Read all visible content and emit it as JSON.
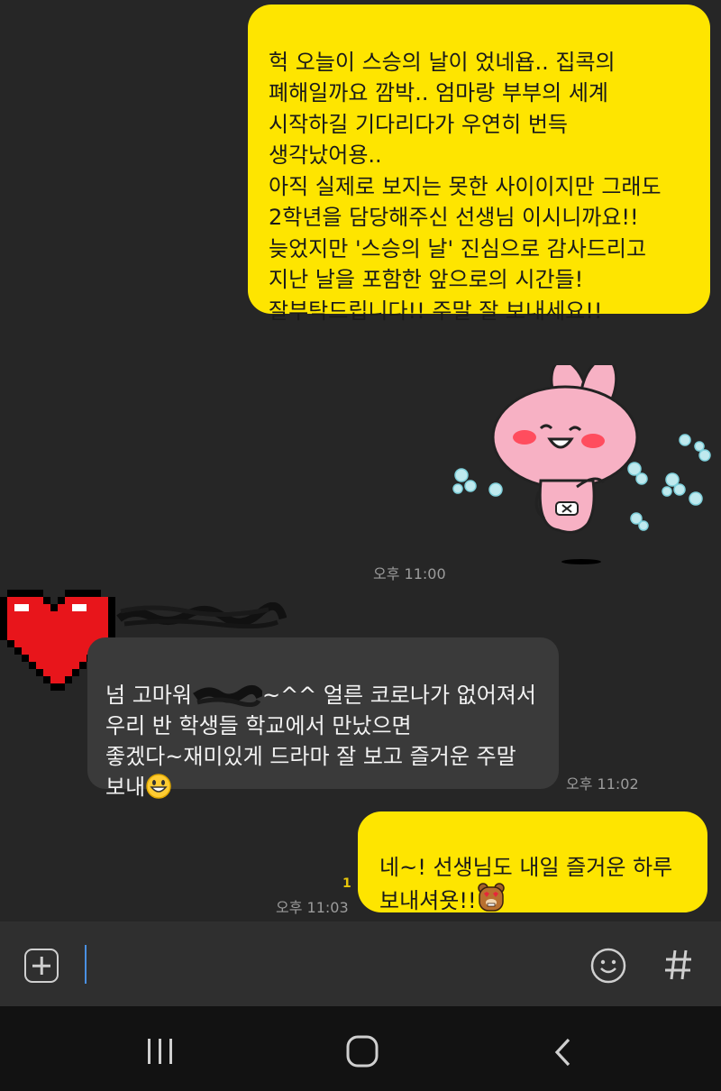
{
  "messages": {
    "sent_1": {
      "text": "헉 오늘이 스승의 날이 었네욥.. 집콕의\n폐해일까요 깜박.. 엄마랑 부부의 세계\n시작하길 기다리다가 우연히 번득\n생각났어용..\n아직 실제로 보지는 못한 사이이지만 그래도\n2학년을 담당해주신 선생님 이시니까요!!\n늦었지만 '스승의 날' 진심으로 감사드리고\n지난 날을 포함한  앞으로의 시간들!\n잘부탁드립니다!! 주말 잘 보내세요!!",
      "time": "오후 11:00",
      "sticker": "pink-rabbit-sticker"
    },
    "received_1": {
      "text_before": "넘 고마워",
      "text_after": "~^^ 얼른 코로나가 없어져서\n우리 반 학생들 학교에서 만났으면\n좋겠다~재미있게 드라마 잘 보고 즐거운 주말\n보내",
      "emoji": "grinning-face-emoji",
      "time": "오후 11:02"
    },
    "sent_2": {
      "text": "네~! 선생님도 내일 즐거운 하루\n보내셔욧!!",
      "emoji": "bear-heart-eyes-emoticon",
      "time": "오후 11:03",
      "unread_count": "1"
    }
  },
  "colors": {
    "sent_bubble": "#fee500",
    "received_bubble": "#3a3a3a",
    "background": "#262626"
  },
  "icons": {
    "attach": "plus-square-icon",
    "emoticon": "smiley-icon",
    "hashtag": "hash-icon",
    "nav_recents": "recents-icon",
    "nav_home": "home-icon",
    "nav_back": "back-icon"
  }
}
